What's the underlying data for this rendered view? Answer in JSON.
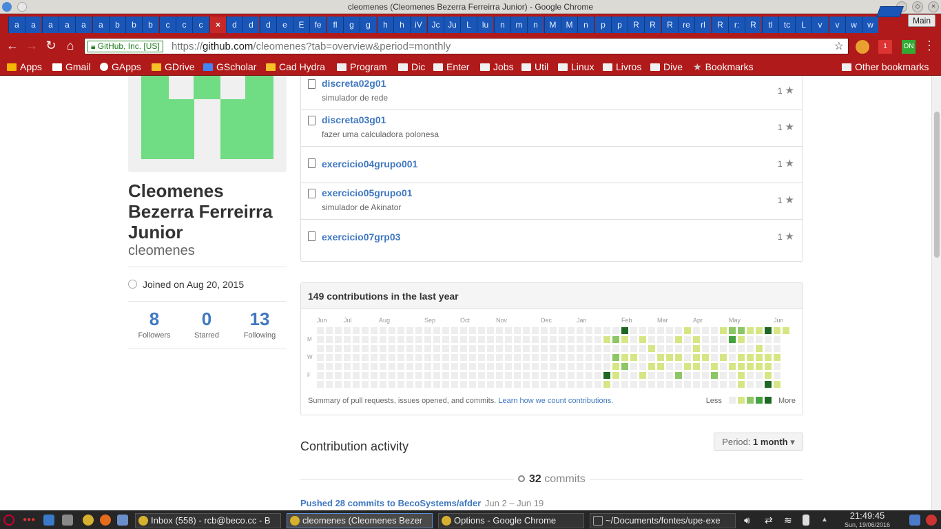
{
  "window": {
    "title": "cleomenes (Cleomenes Bezerra Ferreirra Junior) - Google Chrome"
  },
  "tabs": [
    "a",
    "a",
    "a",
    "a",
    "a",
    "a",
    "b",
    "b",
    "b",
    "c",
    "c",
    "c",
    "×",
    "d",
    "d",
    "d",
    "e",
    "E",
    "fe",
    "fl",
    "g",
    "g",
    "h",
    "h",
    "iV",
    "Jc",
    "Ju",
    "L",
    "lu",
    "n",
    "m",
    "n",
    "M",
    "M",
    "n",
    "p",
    "p",
    "R",
    "R",
    "R",
    "re",
    "rl",
    "R",
    "r:",
    "R",
    "tl",
    "tc",
    "L",
    "v",
    "v",
    "w",
    "w"
  ],
  "active_tab_index": 12,
  "profile_button": "Main",
  "toolbar": {
    "secure_label": "GitHub, Inc. [US]",
    "url_scheme": "https://",
    "url_host": "github.com",
    "url_path": "/cleomenes?tab=overview&period=monthly",
    "ext_badge_1": "1",
    "ext_badge_2": "ON"
  },
  "bookmarks": [
    {
      "label": "Apps",
      "icon": "apps-grid-icon"
    },
    {
      "label": "Gmail",
      "icon": "gmail-icon"
    },
    {
      "label": "GApps",
      "icon": "google-icon"
    },
    {
      "label": "GDrive",
      "icon": "drive-icon"
    },
    {
      "label": "GScholar",
      "icon": "scholar-icon"
    },
    {
      "label": "Cad Hydra",
      "icon": "drive-icon"
    },
    {
      "label": "Program",
      "icon": "folder-icon"
    },
    {
      "label": "Dic",
      "icon": "folder-icon"
    },
    {
      "label": "Enter",
      "icon": "folder-icon"
    },
    {
      "label": "Jobs",
      "icon": "folder-icon"
    },
    {
      "label": "Util",
      "icon": "folder-icon"
    },
    {
      "label": "Linux",
      "icon": "folder-icon"
    },
    {
      "label": "Livros",
      "icon": "folder-icon"
    },
    {
      "label": "Dive",
      "icon": "folder-icon"
    },
    {
      "label": "Bookmarks",
      "icon": "star-icon"
    }
  ],
  "other_bookmarks": "Other bookmarks",
  "profile": {
    "name": "Cleomenes Bezerra Ferreirra Junior",
    "login": "cleomenes",
    "joined": "Joined on Aug 20, 2015",
    "stats": [
      {
        "value": "8",
        "label": "Followers"
      },
      {
        "value": "0",
        "label": "Starred"
      },
      {
        "value": "13",
        "label": "Following"
      }
    ]
  },
  "repos": [
    {
      "name": "discreta02g01",
      "description": "simulador de rede",
      "stars": "1"
    },
    {
      "name": "discreta03g01",
      "description": "fazer uma calculadora polonesa",
      "stars": "1"
    },
    {
      "name": "exercicio04grupo001",
      "description": "",
      "stars": "1"
    },
    {
      "name": "exercicio05grupo01",
      "description": "simulador de Akinator",
      "stars": "1"
    },
    {
      "name": "exercicio07grp03",
      "description": "",
      "stars": "1"
    }
  ],
  "contributions": {
    "title": "149 contributions in the last year",
    "months": [
      "Jun",
      "Jul",
      "Aug",
      "Sep",
      "Oct",
      "Nov",
      "Dec",
      "Jan",
      "Feb",
      "Mar",
      "Apr",
      "May",
      "Jun"
    ],
    "day_labels": [
      "M",
      "W",
      "F"
    ],
    "summary_text": "Summary of pull requests, issues opened, and commits.",
    "summary_link": "Learn how we count contributions.",
    "legend_less": "Less",
    "legend_more": "More",
    "colors": [
      "#eeeeee",
      "#d6e685",
      "#8cc665",
      "#44a340",
      "#1e6823"
    ],
    "active_weeks": [
      [
        0,
        1,
        0,
        0,
        0,
        4,
        1
      ],
      [
        0,
        2,
        0,
        2,
        1,
        1,
        0
      ],
      [
        4,
        1,
        0,
        1,
        2,
        0,
        0
      ],
      [
        0,
        0,
        0,
        1,
        0,
        0,
        0
      ],
      [
        0,
        1,
        0,
        0,
        0,
        1,
        0
      ],
      [
        0,
        0,
        1,
        0,
        1,
        0,
        0
      ],
      [
        0,
        0,
        0,
        1,
        1,
        0,
        0
      ],
      [
        0,
        0,
        0,
        1,
        0,
        0,
        0
      ],
      [
        0,
        1,
        0,
        1,
        0,
        2,
        0
      ],
      [
        1,
        0,
        0,
        0,
        1,
        0,
        0
      ],
      [
        0,
        1,
        1,
        1,
        1,
        0,
        0
      ],
      [
        0,
        0,
        0,
        1,
        0,
        0,
        0
      ],
      [
        0,
        0,
        0,
        0,
        1,
        2,
        0
      ],
      [
        1,
        0,
        0,
        1,
        0,
        0,
        0
      ],
      [
        2,
        3,
        0,
        0,
        1,
        0,
        0
      ],
      [
        2,
        1,
        0,
        1,
        1,
        1,
        1
      ],
      [
        1,
        0,
        0,
        1,
        1,
        0,
        0
      ],
      [
        1,
        0,
        1,
        1,
        1,
        0,
        0
      ],
      [
        4,
        0,
        0,
        1,
        1,
        1,
        4
      ],
      [
        1,
        0,
        0,
        1,
        0,
        0,
        1
      ],
      [
        1,
        0,
        0,
        0,
        0,
        0,
        0
      ]
    ]
  },
  "activity": {
    "title": "Contribution activity",
    "period_label": "Period:",
    "period_value": "1 month",
    "commits_count": "32",
    "commits_word": "commits",
    "pushed_text": "Pushed 28 commits to BecoSystems/afder",
    "pushed_date": "Jun 2 – Jun 19"
  },
  "taskbar": {
    "tasks": [
      {
        "label": "Inbox (558) - rcb@beco.cc - B",
        "active": false
      },
      {
        "label": "cleomenes (Cleomenes Bezer",
        "active": true
      },
      {
        "label": "Options - Google Chrome",
        "active": false
      },
      {
        "label": "~/Documents/fontes/upe-exe",
        "active": false
      }
    ],
    "time": "21:49:45",
    "date": "Sun, 19/06/2016"
  }
}
